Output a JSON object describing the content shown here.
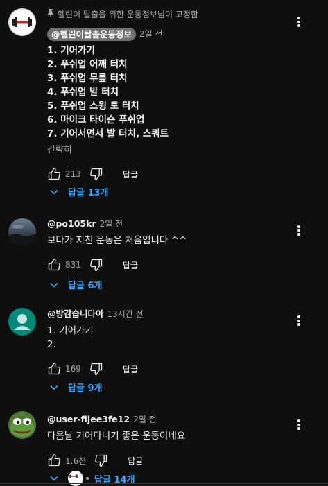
{
  "pinned_label": "헬린이 탈출을 위한 운동정보님이 고정함",
  "reply_label": "답글",
  "comments": [
    {
      "author": "@헬린이탈출운동정보",
      "time": "2일 전",
      "text": "1. 기어가기\n2. 푸쉬업 어깨 터치\n3. 푸쉬업 무릎 터치\n4. 푸쉬업 발 터치\n5. 푸쉬업 스윙 토 터치\n6. 마이크 타이슨 푸쉬업\n7. 기어서면서 발 터치, 스쿼트",
      "read_more": "간략히",
      "likes": "213",
      "replies": "답글 13개"
    },
    {
      "author": "@po105kr",
      "time": "2일 전",
      "text": "보다가 지친 운동은 처음입니다 ^^",
      "likes": "831",
      "replies": "답글 6개"
    },
    {
      "author": "@방감습니다아",
      "time": "13시간 전",
      "text": "1. 기어가기\n2.",
      "likes": "169",
      "replies": "답글 9개"
    },
    {
      "author": "@user-fijee3fe12",
      "time": "2일 전",
      "text": "다음날 기어다니기 좋은 운동이네요",
      "likes": "1.6천",
      "replies": "답글 14개"
    }
  ],
  "icons": {
    "like": "thumb-up-icon",
    "dislike": "thumb-down-icon",
    "expand": "chevron-down-icon",
    "more": "more-vert-icon",
    "pin": "pin-icon"
  },
  "colors": {
    "background": "#0f0f0f",
    "link": "#3ea6ff",
    "secondary_text": "#aaaaaa",
    "author_chip": "#717171",
    "default_avatar": "#00897b"
  }
}
